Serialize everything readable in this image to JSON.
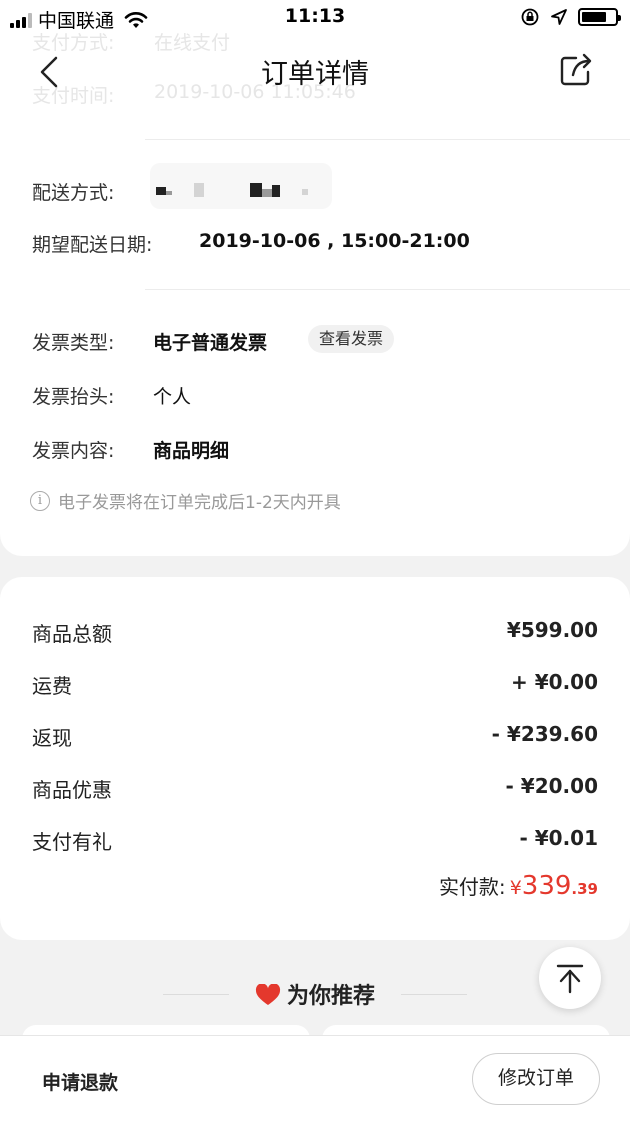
{
  "status_bar": {
    "carrier": "中国联通",
    "time": "11:13",
    "battery_level": 0.75
  },
  "header": {
    "title": "订单详情",
    "ghost_rows": [
      {
        "label": "支付方式:",
        "value": "在线支付"
      },
      {
        "label": "支付时间:",
        "value": "2019-10-06 11:05:46"
      }
    ]
  },
  "delivery": {
    "method_label": "配送方式:",
    "date_label": "期望配送日期:",
    "date_value": "2019-10-06 , 15:00-21:00"
  },
  "invoice": {
    "type_label": "发票类型:",
    "type_value": "电子普通发票",
    "view_button": "查看发票",
    "title_label": "发票抬头:",
    "title_value": "个人",
    "content_label": "发票内容:",
    "content_value": "商品明细",
    "notice_icon": "i",
    "notice": "电子发票将在订单完成后1-2天内开具"
  },
  "price": {
    "rows": [
      {
        "label": "商品总额",
        "value": "¥599.00"
      },
      {
        "label": "运费",
        "value": "+ ¥0.00"
      },
      {
        "label": "返现",
        "value": "- ¥239.60"
      },
      {
        "label": "商品优惠",
        "value": "- ¥20.00"
      },
      {
        "label": "支付有礼",
        "value": "- ¥0.01"
      }
    ],
    "total_label": "实付款:",
    "total_symbol": "¥",
    "total_int": "339",
    "total_dec": ".39"
  },
  "recommend": {
    "title": "为你推荐"
  },
  "bottom": {
    "refund": "申请退款",
    "modify": "修改订单"
  },
  "colors": {
    "accent_red": "#e4382d",
    "background": "#f2f2f2"
  }
}
